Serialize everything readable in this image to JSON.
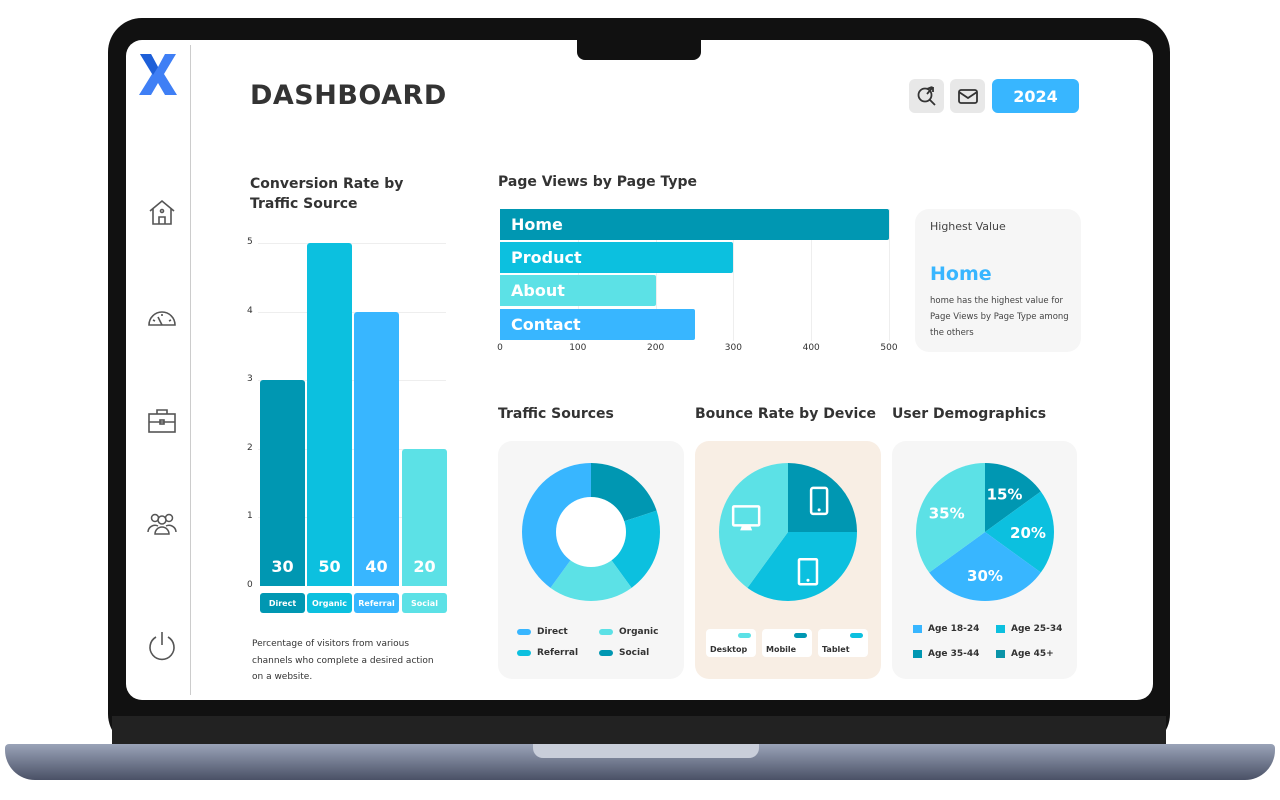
{
  "header": {
    "title": "DASHBOARD",
    "year_label": "2024",
    "icons": [
      "analytics-search-icon",
      "mail-icon"
    ]
  },
  "sidebar": {
    "logo": "X",
    "items": [
      {
        "icon": "home-icon"
      },
      {
        "icon": "gauge-icon"
      },
      {
        "icon": "briefcase-icon"
      },
      {
        "icon": "users-icon"
      },
      {
        "icon": "power-icon"
      }
    ]
  },
  "colors": {
    "dark_teal": "#0097b2",
    "cyan": "#0cc0df",
    "light_cyan": "#5ce1e6",
    "blue": "#38b6ff"
  },
  "conversion": {
    "title_line1": "Conversion Rate by",
    "title_line2": "Traffic Source",
    "description": "Percentage of visitors from various channels who complete a desired action on a website."
  },
  "page_views": {
    "title": "Page Views by Page Type",
    "highest": {
      "heading": "Highest Value",
      "value": "Home",
      "description": "home has the highest value for Page Views by Page Type among the others"
    }
  },
  "traffic": {
    "title": "Traffic Sources"
  },
  "bounce": {
    "title": "Bounce Rate by Device"
  },
  "demographics": {
    "title": "User Demographics"
  },
  "chart_data": [
    {
      "type": "bar",
      "categories": [
        "Direct",
        "Organic",
        "Referral",
        "Social"
      ],
      "values": [
        3,
        5,
        4,
        2
      ],
      "data_labels": [
        "30",
        "50",
        "40",
        "20"
      ],
      "ylim": [
        0,
        5
      ],
      "yticks": [
        "0",
        "1",
        "2",
        "3",
        "4",
        "5"
      ],
      "colors": [
        "#0097b2",
        "#0cc0df",
        "#38b6ff",
        "#5ce1e6"
      ],
      "grid": true
    },
    {
      "type": "bar",
      "orientation": "horizontal",
      "categories": [
        "Home",
        "Product",
        "About",
        "Contact"
      ],
      "values": [
        500,
        300,
        200,
        250
      ],
      "xlim": [
        0,
        500
      ],
      "xticks": [
        "0",
        "100",
        "200",
        "300",
        "400",
        "500"
      ],
      "colors": [
        "#0097b2",
        "#0cc0df",
        "#5ce1e6",
        "#38b6ff"
      ],
      "grid": true
    },
    {
      "type": "pie",
      "donut": true,
      "labels": [
        "Social",
        "Referral",
        "Organic",
        "Direct"
      ],
      "values": [
        20,
        20,
        20,
        40
      ],
      "colors": [
        "#0097b2",
        "#0cc0df",
        "#5ce1e6",
        "#38b6ff"
      ],
      "legend": [
        "Direct",
        "Organic",
        "Referral",
        "Social"
      ],
      "legend_colors": [
        "#38b6ff",
        "#5ce1e6",
        "#0cc0df",
        "#0097b2"
      ]
    },
    {
      "type": "pie",
      "labels": [
        "Mobile",
        "Tablet",
        "Desktop"
      ],
      "values": [
        25,
        35,
        40
      ],
      "colors": [
        "#0097b2",
        "#0cc0df",
        "#5ce1e6"
      ],
      "legend": [
        "Desktop",
        "Mobile",
        "Tablet"
      ],
      "legend_colors": [
        "#5ce1e6",
        "#0097b2",
        "#0cc0df"
      ]
    },
    {
      "type": "pie",
      "labels": [
        "15%",
        "20%",
        "30%",
        "35%"
      ],
      "values": [
        15,
        20,
        30,
        35
      ],
      "colors": [
        "#0097b2",
        "#0cc0df",
        "#38b6ff",
        "#5ce1e6"
      ],
      "legend": [
        "Age 18-24",
        "Age 25-34",
        "Age 35-44",
        "Age 45+"
      ],
      "legend_colors": [
        "#38b6ff",
        "#0cc0df",
        "#0097b2",
        "#0a94a8"
      ]
    }
  ]
}
